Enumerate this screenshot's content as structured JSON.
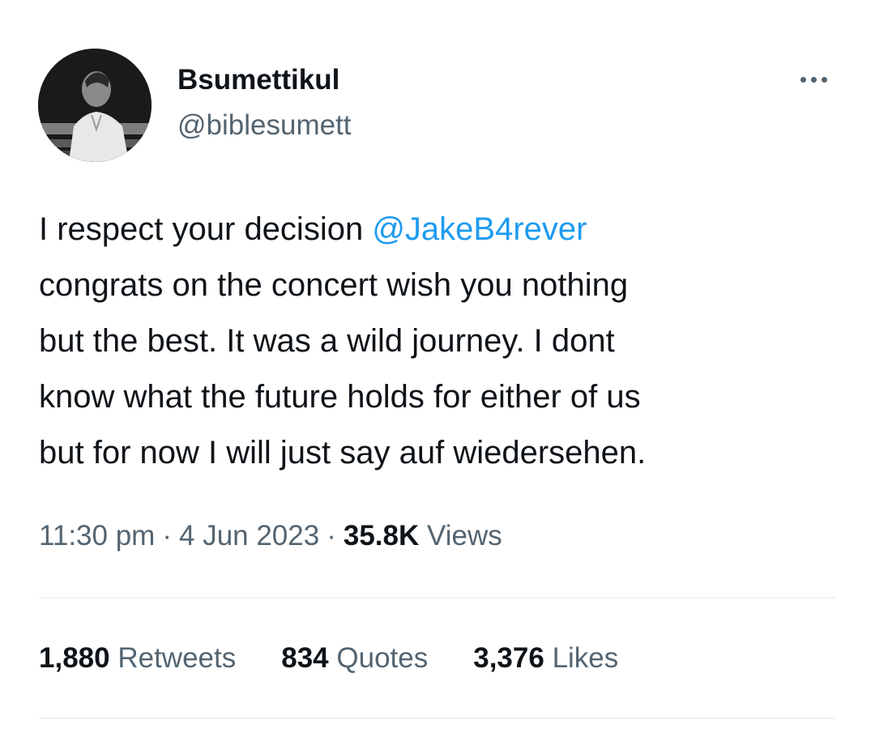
{
  "author": {
    "display_name": "Bsumettikul",
    "handle": "@biblesumett",
    "avatar_icon": "profile-photo"
  },
  "tweet": {
    "text_lines": [
      {
        "before": "I respect your decision ",
        "mention": "@JakeB4rever"
      },
      {
        "text": "congrats on the concert wish you nothing"
      },
      {
        "text": "but the best. It was a wild journey. I dont"
      },
      {
        "text": "know what the future holds for either of us"
      },
      {
        "text": "but for now I will just say auf wiedersehen."
      }
    ],
    "time": "11:30 pm",
    "date": "4 Jun 2023",
    "views_count": "35.8K",
    "views_label": "Views",
    "separator": "·"
  },
  "stats": {
    "retweets_count": "1,880",
    "retweets_label": "Retweets",
    "quotes_count": "834",
    "quotes_label": "Quotes",
    "likes_count": "3,376",
    "likes_label": "Likes"
  },
  "colors": {
    "link": "#1d9bf0",
    "text": "#0f1419",
    "secondary": "#536471",
    "divider": "#eff3f4"
  }
}
